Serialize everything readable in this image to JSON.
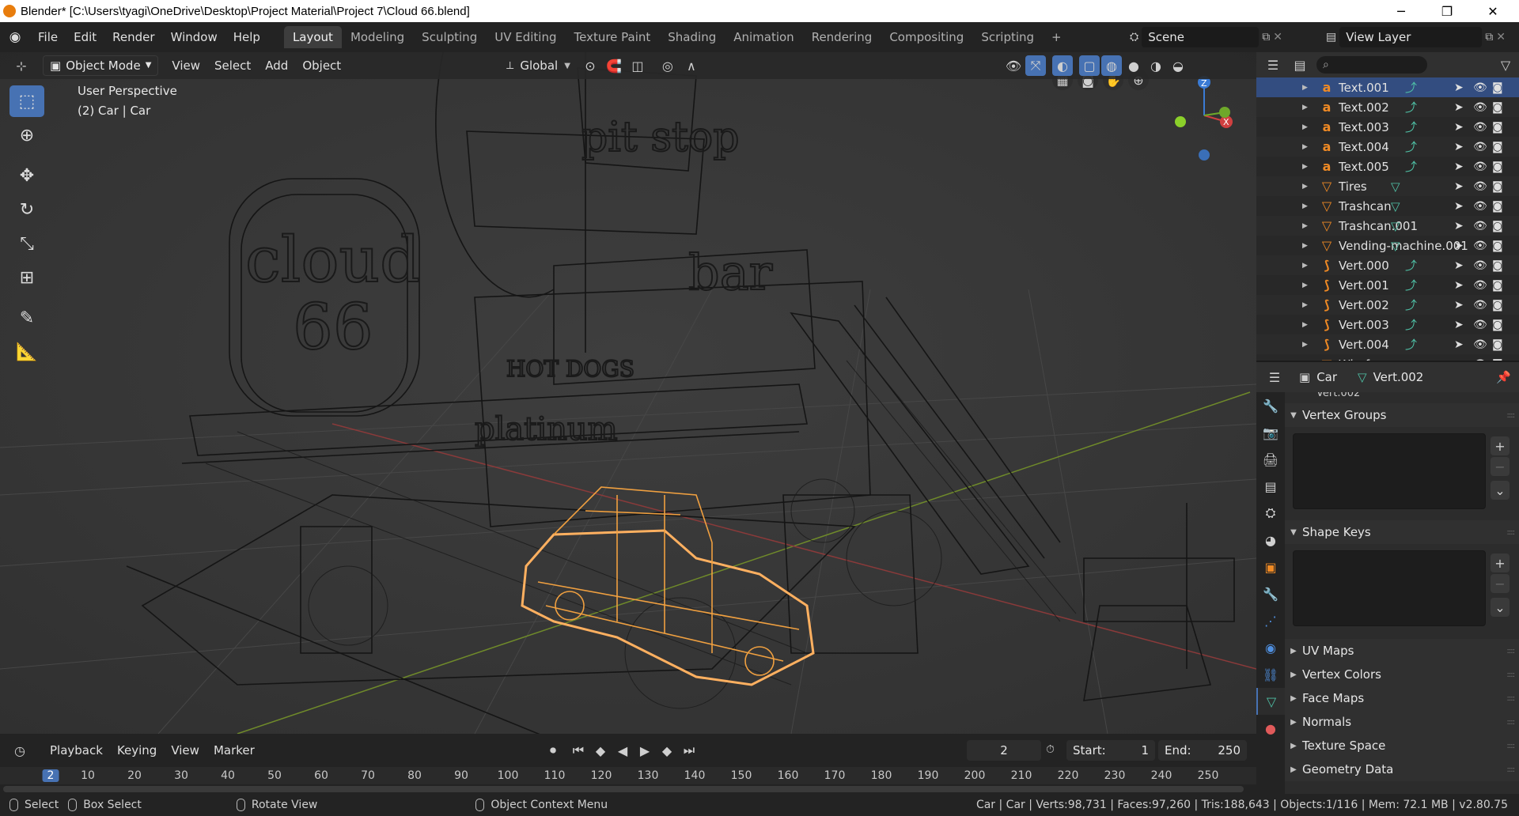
{
  "window": {
    "title": "Blender* [C:\\Users\\tyagi\\OneDrive\\Desktop\\Project Material\\Project 7\\Cloud 66.blend]",
    "minimize": "─",
    "restore": "❐",
    "close": "✕"
  },
  "topbar": {
    "menus": [
      "File",
      "Edit",
      "Render",
      "Window",
      "Help"
    ],
    "workspaces": [
      "Layout",
      "Modeling",
      "Sculpting",
      "UV Editing",
      "Texture Paint",
      "Shading",
      "Animation",
      "Rendering",
      "Compositing",
      "Scripting"
    ],
    "active_workspace": "Layout",
    "add_tab": "+",
    "scene_label": "Scene",
    "view_layer_label": "View Layer"
  },
  "viewport_header": {
    "mode": "Object Mode",
    "menus": [
      "View",
      "Select",
      "Add",
      "Object"
    ],
    "transform_orientation": "Global"
  },
  "viewport": {
    "perspective": "User Perspective",
    "context": "(2) Car | Car",
    "gizmo": {
      "z": "Z",
      "x": "X"
    },
    "scene_text": [
      "cloud",
      "66",
      "bar",
      "pit stop",
      "HOT DOGS",
      "platinum"
    ]
  },
  "toolbar": {
    "tools": [
      "select-box-icon",
      "cursor-icon",
      "move-icon",
      "rotate-icon",
      "scale-icon",
      "transform-icon",
      "annotate-icon",
      "measure-icon"
    ]
  },
  "outliner": {
    "rows": [
      {
        "name": "Text.001",
        "type": "text"
      },
      {
        "name": "Text.002",
        "type": "text"
      },
      {
        "name": "Text.003",
        "type": "text"
      },
      {
        "name": "Text.004",
        "type": "text"
      },
      {
        "name": "Text.005",
        "type": "text"
      },
      {
        "name": "Tires",
        "type": "mesh"
      },
      {
        "name": "Trashcan",
        "type": "mesh"
      },
      {
        "name": "Trashcan.001",
        "type": "mesh"
      },
      {
        "name": "Vending-machine.001",
        "type": "mesh"
      },
      {
        "name": "Vert.000",
        "type": "curve"
      },
      {
        "name": "Vert.001",
        "type": "curve"
      },
      {
        "name": "Vert.002",
        "type": "curve"
      },
      {
        "name": "Vert.003",
        "type": "curve"
      },
      {
        "name": "Vert.004",
        "type": "curve"
      },
      {
        "name": "Wireframe",
        "type": "mesh"
      }
    ]
  },
  "properties": {
    "object": "Car",
    "data": "Vert.002",
    "clipped_field": "Vert.002",
    "panels": {
      "vertex_groups": "Vertex Groups",
      "shape_keys": "Shape Keys",
      "uv_maps": "UV Maps",
      "vertex_colors": "Vertex Colors",
      "face_maps": "Face Maps",
      "normals": "Normals",
      "texture_space": "Texture Space",
      "geometry_data": "Geometry Data"
    }
  },
  "timeline": {
    "menus": [
      "Playback",
      "Keying",
      "View",
      "Marker"
    ],
    "current_frame": "2",
    "start_label": "Start:",
    "start": "1",
    "end_label": "End:",
    "end": "250",
    "ticks": [
      "2",
      "10",
      "20",
      "30",
      "40",
      "50",
      "60",
      "70",
      "80",
      "90",
      "100",
      "110",
      "120",
      "130",
      "140",
      "150",
      "160",
      "170",
      "180",
      "190",
      "200",
      "210",
      "220",
      "230",
      "240",
      "250"
    ]
  },
  "statusbar": {
    "select": "Select",
    "box_select": "Box Select",
    "rotate_view": "Rotate View",
    "context_menu": "Object Context Menu",
    "stats": "Car | Car | Verts:98,731 | Faces:97,260 | Tris:188,643 | Objects:1/116 | Mem: 72.1 MB | v2.80.75"
  },
  "colors": {
    "accent": "#4772b3",
    "selection_orange": "#f0a040",
    "active_orange": "#ffb060",
    "teal": "#4fc1a6"
  }
}
